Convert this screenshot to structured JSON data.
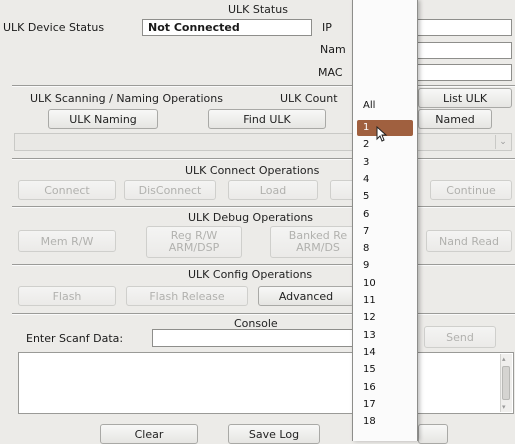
{
  "status": {
    "section_title": "ULK Status",
    "device_status_label": "ULK Device Status",
    "device_status_value": "Not Connected",
    "ip_label": "IP",
    "name_label": "Nam",
    "mac_label": "MAC"
  },
  "scanning": {
    "section_title": "ULK Scanning / Naming Operations",
    "count_label": "ULK Count",
    "list_button": "List ULK",
    "naming_button": "ULK Naming",
    "find_button": "Find ULK",
    "named_button": "Named"
  },
  "connect": {
    "section_title": "ULK Connect Operations",
    "connect_button": "Connect",
    "disconnect_button": "DisConnect",
    "load_button": "Load",
    "continue_button": "Continue"
  },
  "debug": {
    "section_title": "ULK Debug Operations",
    "memrw_button": "Mem R/W",
    "regrw_line1": "Reg R/W",
    "regrw_line2": "ARM/DSP",
    "banked_line1": "Banked Re",
    "banked_line2": "ARM/DS",
    "nandread_button": "Nand Read"
  },
  "config": {
    "section_title": "ULK Config Operations",
    "flash_button": "Flash",
    "flash_release_button": "Flash Release",
    "advanced_button": "Advanced"
  },
  "console": {
    "section_title": "Console",
    "scanf_label": "Enter Scanf Data:",
    "send_button": "Send",
    "clear_button": "Clear",
    "save_log_button": "Save Log"
  },
  "dropdown": {
    "options": [
      "All",
      "1",
      "2",
      "3",
      "4",
      "5",
      "6",
      "7",
      "8",
      "9",
      "10",
      "11",
      "12",
      "13",
      "14",
      "15",
      "16",
      "17",
      "18"
    ],
    "selected": "1"
  }
}
